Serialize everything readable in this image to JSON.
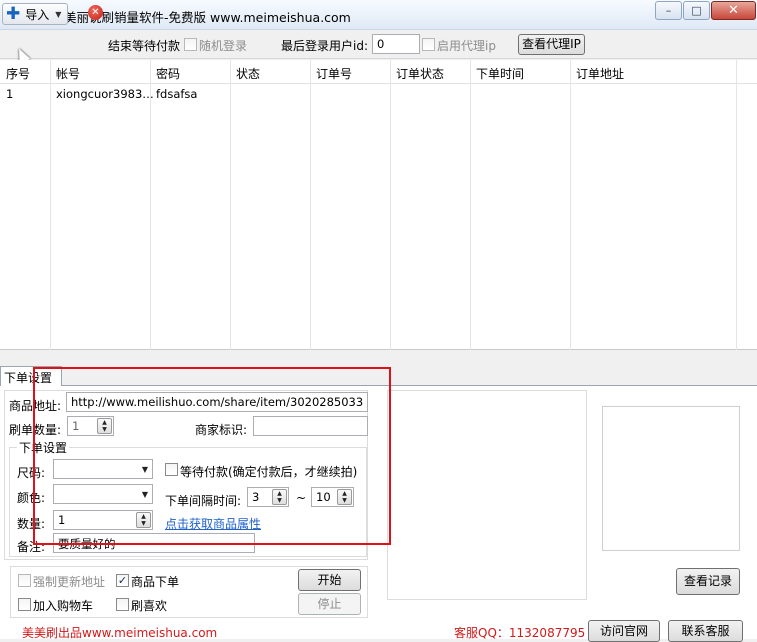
{
  "window": {
    "title": "美美刷-美丽说刷销量软件-免费版 www.meimeishua.com",
    "minimize_glyph": "–",
    "maximize_glyph": "□",
    "close_glyph": "✕"
  },
  "toolbar": {
    "import_label": "导入",
    "end_wait_label": "结束等待付款",
    "random_login_label": "随机登录",
    "random_login_checked": false,
    "last_user_label": "最后登录用户id:",
    "last_user_value": "0",
    "enable_proxy_label": "启用代理ip",
    "enable_proxy_checked": false,
    "view_proxy_label": "查看代理IP"
  },
  "table": {
    "columns": [
      "序号",
      "帐号",
      "密码",
      "状态",
      "订单号",
      "订单状态",
      "下单时间",
      "订单地址"
    ],
    "rows": [
      [
        "1",
        "xiongcuor3983…",
        "fdsafsa",
        "",
        "",
        "",
        "",
        ""
      ]
    ]
  },
  "order_settings": {
    "tab_label": "下单设置",
    "product_url_label": "商品地址:",
    "product_url_value": "http://www.meilishuo.com/share/item/3020285033",
    "quantity_label": "刷单数量:",
    "quantity_value": "1",
    "merchant_label": "商家标识:",
    "merchant_value": "",
    "sub_group_label": "下单设置",
    "size_label": "尺码:",
    "size_value": "",
    "color_label": "颜色:",
    "color_value": "",
    "amount_label": "数量:",
    "amount_value": "1",
    "wait_payment_label": "等待付款(确定付款后，才继续拍)",
    "wait_payment_checked": false,
    "interval_label": "下单间隔时间:",
    "interval_min": "3",
    "interval_sep": "~",
    "interval_max": "10",
    "fetch_attr_link": "点击获取商品属性",
    "note_label": "备注:",
    "note_value": "要质量好的"
  },
  "options": {
    "force_update_label": "强制更新地址",
    "force_update_checked": false,
    "product_order_label": "商品下单",
    "product_order_checked": true,
    "add_cart_label": "加入购物车",
    "add_cart_checked": false,
    "like_label": "刷喜欢",
    "like_checked": false,
    "start_label": "开始",
    "stop_label": "停止"
  },
  "right_panel": {
    "view_records_label": "查看记录"
  },
  "footer": {
    "brand_text": "美美刷出品www.meimeishua.com",
    "qq_text": "客服QQ：1132087795",
    "visit_site_label": "访问官网",
    "contact_label": "联系客服"
  },
  "colors": {
    "highlight_box": "#e0101a",
    "link": "#1f61c9",
    "footer_red": "#d11a1a"
  }
}
